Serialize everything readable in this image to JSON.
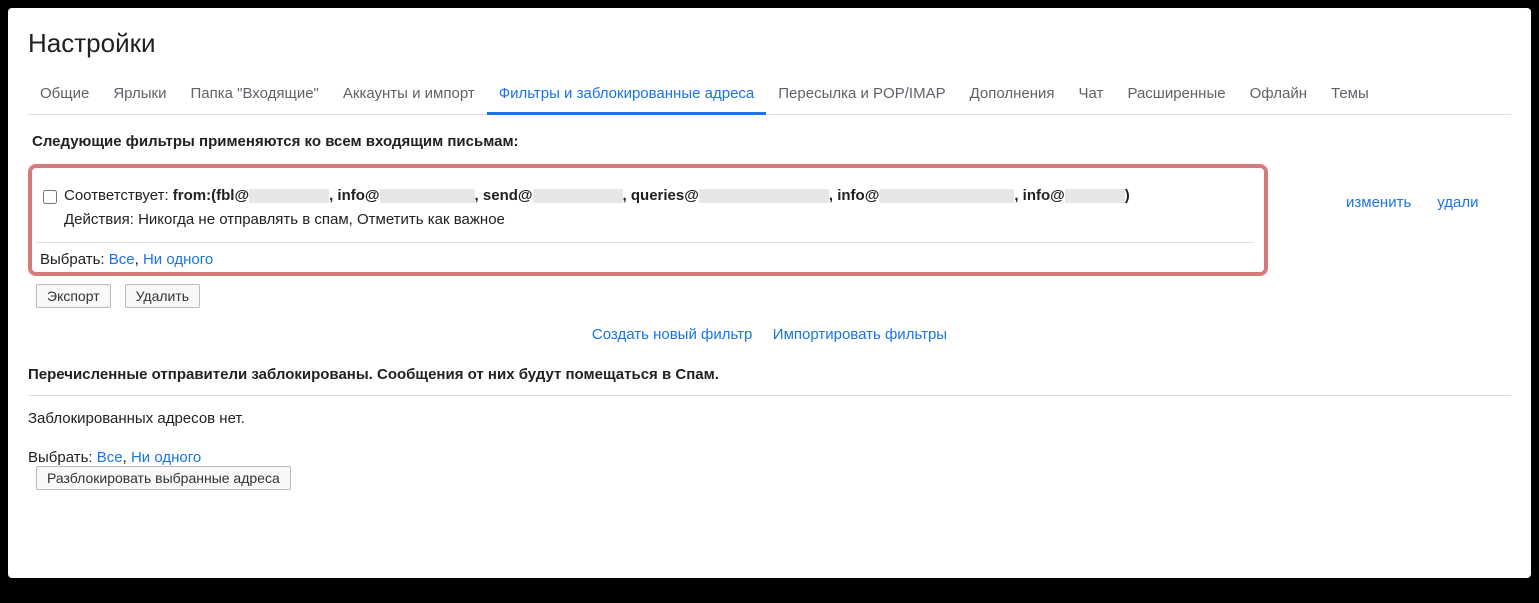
{
  "page_title": "Настройки",
  "tabs": [
    {
      "label": "Общие",
      "active": false
    },
    {
      "label": "Ярлыки",
      "active": false
    },
    {
      "label": "Папка \"Входящие\"",
      "active": false
    },
    {
      "label": "Аккаунты и импорт",
      "active": false
    },
    {
      "label": "Фильтры и заблокированные адреса",
      "active": true
    },
    {
      "label": "Пересылка и POP/IMAP",
      "active": false
    },
    {
      "label": "Дополнения",
      "active": false
    },
    {
      "label": "Чат",
      "active": false
    },
    {
      "label": "Расширенные",
      "active": false
    },
    {
      "label": "Офлайн",
      "active": false
    },
    {
      "label": "Темы",
      "active": false
    }
  ],
  "filters": {
    "intro": "Следующие фильтры применяются ко всем входящим письмам:",
    "match_label": "Соответствует: ",
    "match_parts": {
      "prefix": "from:(fbl@",
      "sep": ", ",
      "p2": "info@",
      "p3": "send@",
      "p4": "queries@",
      "p5": "info@",
      "p6": "info@",
      "suffix": ")"
    },
    "actions_label": "Действия: ",
    "actions_value": "Никогда не отправлять в спам, Отметить как важное",
    "edit_link": "изменить",
    "delete_link": "удали",
    "select_label": "Выбрать: ",
    "select_all": "Все",
    "select_sep": ", ",
    "select_none": "Ни одного",
    "export_btn": "Экспорт",
    "delete_btn": "Удалить",
    "create_link": "Создать новый фильтр",
    "import_link": "Импортировать фильтры"
  },
  "blocked": {
    "intro": "Перечисленные отправители заблокированы. Сообщения от них будут помещаться в Спам.",
    "none": "Заблокированных адресов нет.",
    "select_label": "Выбрать: ",
    "select_all": "Все",
    "select_sep": ", ",
    "select_none": "Ни одного",
    "unblock_btn": "Разблокировать выбранные адреса"
  }
}
